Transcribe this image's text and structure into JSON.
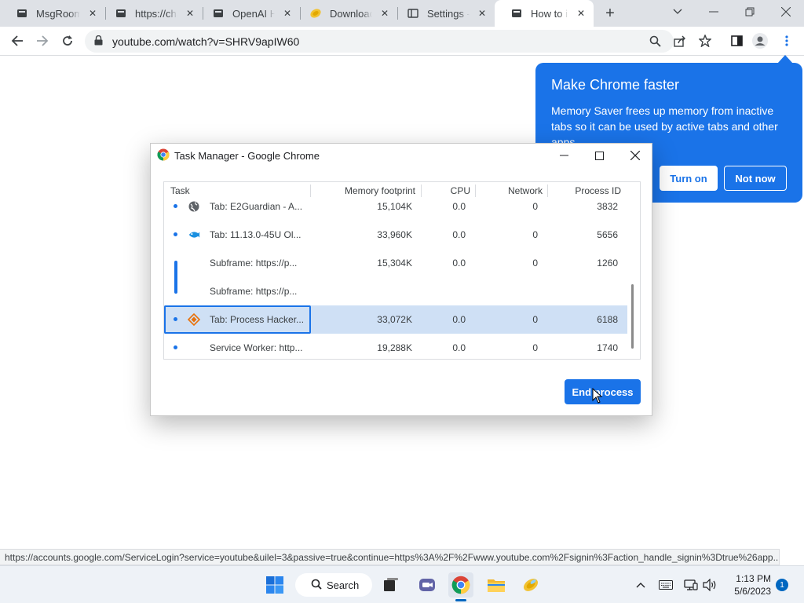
{
  "tabs": [
    {
      "title": "MsgRoom",
      "icon": "page-dark-icon"
    },
    {
      "title": "https://chat",
      "icon": "page-dark-icon"
    },
    {
      "title": "OpenAI He",
      "icon": "page-dark-icon"
    },
    {
      "title": "Download",
      "icon": "coin-icon"
    },
    {
      "title": "Settings - I",
      "icon": "settings-page-icon"
    },
    {
      "title": "How to ins",
      "icon": "page-dark-icon",
      "active": true
    }
  ],
  "address_bar": {
    "url": "youtube.com/watch?v=SHRV9apIW60"
  },
  "promo": {
    "title": "Make Chrome faster",
    "body": "Memory Saver frees up memory from inactive tabs so it can be used by active tabs and other apps.",
    "turn_on_label": "Turn on",
    "not_now_label": "Not now"
  },
  "task_manager": {
    "title": "Task Manager - Google Chrome",
    "columns": {
      "task": "Task",
      "memory": "Memory footprint",
      "cpu": "CPU",
      "network": "Network",
      "pid": "Process ID"
    },
    "rows": [
      {
        "task": "Tab: E2Guardian - A...",
        "memory": "15,104K",
        "cpu": "0.0",
        "network": "0",
        "pid": "3832",
        "icon": "globe-icon"
      },
      {
        "task": "Tab: 11.13.0-45U Ol...",
        "memory": "33,960K",
        "cpu": "0.0",
        "network": "0",
        "pid": "5656",
        "icon": "fish-icon"
      },
      {
        "task": "Subframe: https://p...",
        "memory": "15,304K",
        "cpu": "0.0",
        "network": "0",
        "pid": "1260",
        "icon": ""
      },
      {
        "task": "Subframe: https://p...",
        "memory": "",
        "cpu": "",
        "network": "",
        "pid": "",
        "icon": ""
      },
      {
        "task": "Tab: Process Hacker...",
        "memory": "33,072K",
        "cpu": "0.0",
        "network": "0",
        "pid": "6188",
        "icon": "process-hacker-icon",
        "selected": true
      },
      {
        "task": "Service Worker: http...",
        "memory": "19,288K",
        "cpu": "0.0",
        "network": "0",
        "pid": "1740",
        "icon": ""
      }
    ],
    "end_process_label": "End process"
  },
  "status_url": "https://accounts.google.com/ServiceLogin?service=youtube&uilel=3&passive=true&continue=https%3A%2F%2Fwww.youtube.com%2Fsignin%3Faction_handle_signin%3Dtrue%26app...",
  "taskbar": {
    "search_label": "Search",
    "time": "1:13 PM",
    "date": "5/6/2023",
    "notification_count": "1"
  },
  "colors": {
    "accent": "#1a73e8",
    "selected_row": "#cfe0f5"
  }
}
